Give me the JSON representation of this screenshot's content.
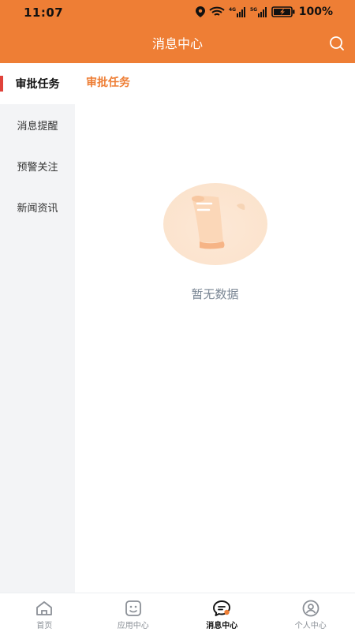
{
  "status_bar": {
    "time": "11:07",
    "battery": "100%"
  },
  "header": {
    "title": "消息中心"
  },
  "sidebar": {
    "items": [
      {
        "label": "审批任务"
      },
      {
        "label": "消息提醒"
      },
      {
        "label": "预警关注"
      },
      {
        "label": "新闻资讯"
      }
    ]
  },
  "content": {
    "title": "审批任务",
    "empty_text": "暂无数据"
  },
  "tabbar": {
    "items": [
      {
        "label": "首页",
        "icon": "home-icon"
      },
      {
        "label": "应用中心",
        "icon": "app-center-icon"
      },
      {
        "label": "消息中心",
        "icon": "message-icon"
      },
      {
        "label": "个人中心",
        "icon": "profile-icon"
      }
    ]
  },
  "colors": {
    "accent": "#ee7e35",
    "active_marker": "#e0423a",
    "sidebar_bg": "#f3f4f6"
  }
}
